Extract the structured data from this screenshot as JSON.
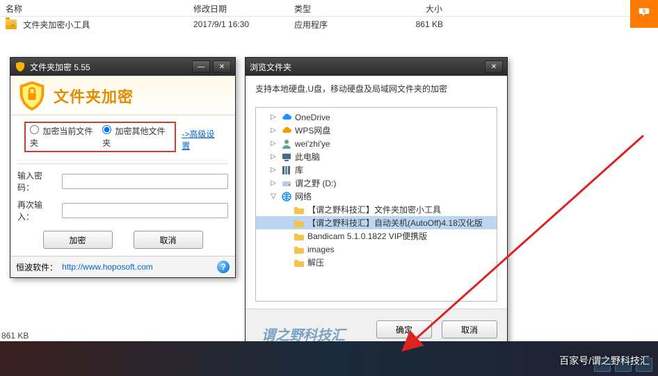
{
  "explorer": {
    "headers": {
      "name": "名称",
      "date": "修改日期",
      "type": "类型",
      "size": "大小"
    },
    "row": {
      "name": "文件夹加密小工具",
      "date": "2017/9/1 16:30",
      "type": "应用程序",
      "size": "861 KB"
    }
  },
  "enc_dialog": {
    "window_title": "文件夹加密 5.55",
    "banner_title": "文件夹加密",
    "radio_current": "加密当前文件夹",
    "radio_other": "加密其他文件夹",
    "advanced_link": "->高级设置",
    "pw_label": "输入密码：",
    "pw2_label": "再次输入：",
    "encrypt_btn": "加密",
    "cancel_btn": "取消",
    "footer_label": "恒波软件：",
    "footer_url": "http://www.hoposoft.com"
  },
  "browse_dialog": {
    "window_title": "浏览文件夹",
    "description": "支持本地硬盘,U盘，移动硬盘及局域网文件夹的加密",
    "tree": [
      {
        "indent": 1,
        "twisty": "▷",
        "icon": "cloud-blue",
        "label": "OneDrive"
      },
      {
        "indent": 1,
        "twisty": "▷",
        "icon": "cloud-orange",
        "label": "WPS网盘"
      },
      {
        "indent": 1,
        "twisty": "▷",
        "icon": "person",
        "label": "wei'zhi'ye"
      },
      {
        "indent": 1,
        "twisty": "▷",
        "icon": "pc",
        "label": "此电脑"
      },
      {
        "indent": 1,
        "twisty": "▷",
        "icon": "lib",
        "label": "库"
      },
      {
        "indent": 1,
        "twisty": "▷",
        "icon": "drive",
        "label": "谓之野 (D:)"
      },
      {
        "indent": 1,
        "twisty": "▽",
        "icon": "net",
        "label": "网络"
      },
      {
        "indent": 2,
        "twisty": "",
        "icon": "folder",
        "label": "【谓之野科技汇】文件夹加密小工具"
      },
      {
        "indent": 2,
        "twisty": "",
        "icon": "folder",
        "label": "【谓之野科技汇】自动关机(AutoOff)4.18汉化版",
        "selected": true
      },
      {
        "indent": 2,
        "twisty": "",
        "icon": "folder",
        "label": "Bandicam 5.1.0.1822 VIP便携版"
      },
      {
        "indent": 2,
        "twisty": "",
        "icon": "folder",
        "label": "images"
      },
      {
        "indent": 2,
        "twisty": "",
        "icon": "folder",
        "label": "解压"
      }
    ],
    "ok_btn": "确定",
    "cancel_btn": "取消"
  },
  "status_bar": "861 KB",
  "watermark": "谓之野科技汇",
  "attribution": "百家号/谓之野科技汇",
  "help_glyph": "?"
}
